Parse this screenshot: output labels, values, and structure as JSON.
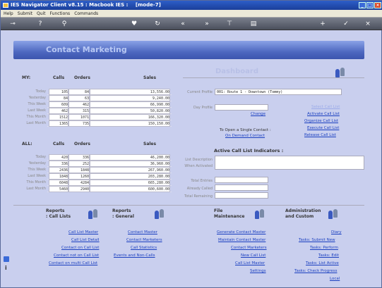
{
  "window": {
    "title": "IES Navigator Client v8.15 : Macbook IES :",
    "mode": "[mode-7]"
  },
  "menu": [
    "Help",
    "Submit",
    "Quit",
    "Functions",
    "Commands"
  ],
  "banner": {
    "title": "Contact Marketing"
  },
  "my": {
    "label": "MY:",
    "headers": [
      "Calls",
      "Orders",
      "Sales"
    ],
    "rows": [
      {
        "label": "Today",
        "calls": "105",
        "orders": "84",
        "sales": "13,556.00"
      },
      {
        "label": "Yesterday",
        "calls": "84",
        "orders": "63",
        "sales": "9,240.00"
      },
      {
        "label": "This Week",
        "calls": "609",
        "orders": "462",
        "sales": "66,990.00"
      },
      {
        "label": "Last Week",
        "calls": "462",
        "orders": "315",
        "sales": "50,820.00"
      },
      {
        "label": "This Month",
        "calls": "1512",
        "orders": "1071",
        "sales": "166,320.00"
      },
      {
        "label": "Last Month",
        "calls": "1365",
        "orders": "735",
        "sales": "150,150.00"
      }
    ]
  },
  "all": {
    "label": "ALL:",
    "headers": [
      "Calls",
      "Orders",
      "Sales"
    ],
    "rows": [
      {
        "label": "Today",
        "calls": "420",
        "orders": "336",
        "sales": "46,200.00"
      },
      {
        "label": "Yesterday",
        "calls": "336",
        "orders": "252",
        "sales": "36,960.00"
      },
      {
        "label": "This Week",
        "calls": "2436",
        "orders": "1848",
        "sales": "267,960.00"
      },
      {
        "label": "Last Week",
        "calls": "1848",
        "orders": "1260",
        "sales": "203,280.00"
      },
      {
        "label": "This Month",
        "calls": "6048",
        "orders": "4284",
        "sales": "665,280.00"
      },
      {
        "label": "Last Month",
        "calls": "5460",
        "orders": "2940",
        "sales": "600,600.00"
      }
    ]
  },
  "dashboard": {
    "title": "Dashboard",
    "current_profile_label": "Current Profile",
    "current_profile_value": "001: Route 1 - Downtown (Tommy)",
    "day_profile_label": "Day Profile",
    "change": "Change",
    "select_call_list": "Select Call List",
    "activate": "Activate Call List",
    "organize": "Organize Call List",
    "execute": "Execute Call List",
    "release": "Release Call List",
    "open_single": "To Open a Single Contact :",
    "on_demand": "On Demand Contact",
    "indicators_title": "Active Call List Indicators :",
    "list_description": "List Description",
    "when_activated": "When Activated",
    "total_entries": "Total Entries",
    "already_called": "Already Called",
    "total_remaining": "Total Remaining"
  },
  "sections": {
    "reports_calls": [
      "Reports",
      ": Call Lists"
    ],
    "reports_general": [
      "Reports",
      ": General"
    ],
    "file_maintenance": [
      "File",
      "Maintenance"
    ],
    "admin_custom": [
      "Administration",
      "and Custom"
    ]
  },
  "links_col1": [
    "Call List Master",
    "Call List Detail",
    "Contact on Call List",
    "Contact not on Call List",
    "Contact on multi Call List"
  ],
  "links_col2": [
    "Contact Master",
    "Contact Marketers",
    "Call Statistics",
    "Events and Non-Calls"
  ],
  "links_col3": [
    "Generate Contact Master",
    "Maintain Contact Master",
    "Contact Marketers",
    "New Call List",
    "Call List Master",
    "Settings"
  ],
  "links_col4": [
    "Diary",
    "Tasks: Submit New",
    "Tasks: Perform",
    "Tasks: Edit",
    "Tasks: List Active",
    "Tasks: Check Progress",
    "Local"
  ]
}
